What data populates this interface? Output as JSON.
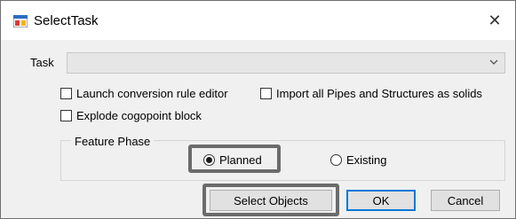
{
  "window": {
    "title": "SelectTask",
    "close_symbol": "✕"
  },
  "task": {
    "label": "Task",
    "value": ""
  },
  "options": {
    "launch_editor": {
      "label": "Launch conversion rule editor",
      "checked": false
    },
    "import_solids": {
      "label": "Import all Pipes and Structures as solids",
      "checked": false
    },
    "explode_block": {
      "label": "Explode cogopoint block",
      "checked": false
    }
  },
  "feature_phase": {
    "label": "Feature Phase",
    "planned": {
      "label": "Planned",
      "selected": true
    },
    "existing": {
      "label": "Existing",
      "selected": false
    }
  },
  "buttons": {
    "select_objects": "Select Objects",
    "ok": "OK",
    "cancel": "Cancel"
  },
  "colors": {
    "highlight": "#6b6b6b",
    "default_button_border": "#0078d7"
  }
}
